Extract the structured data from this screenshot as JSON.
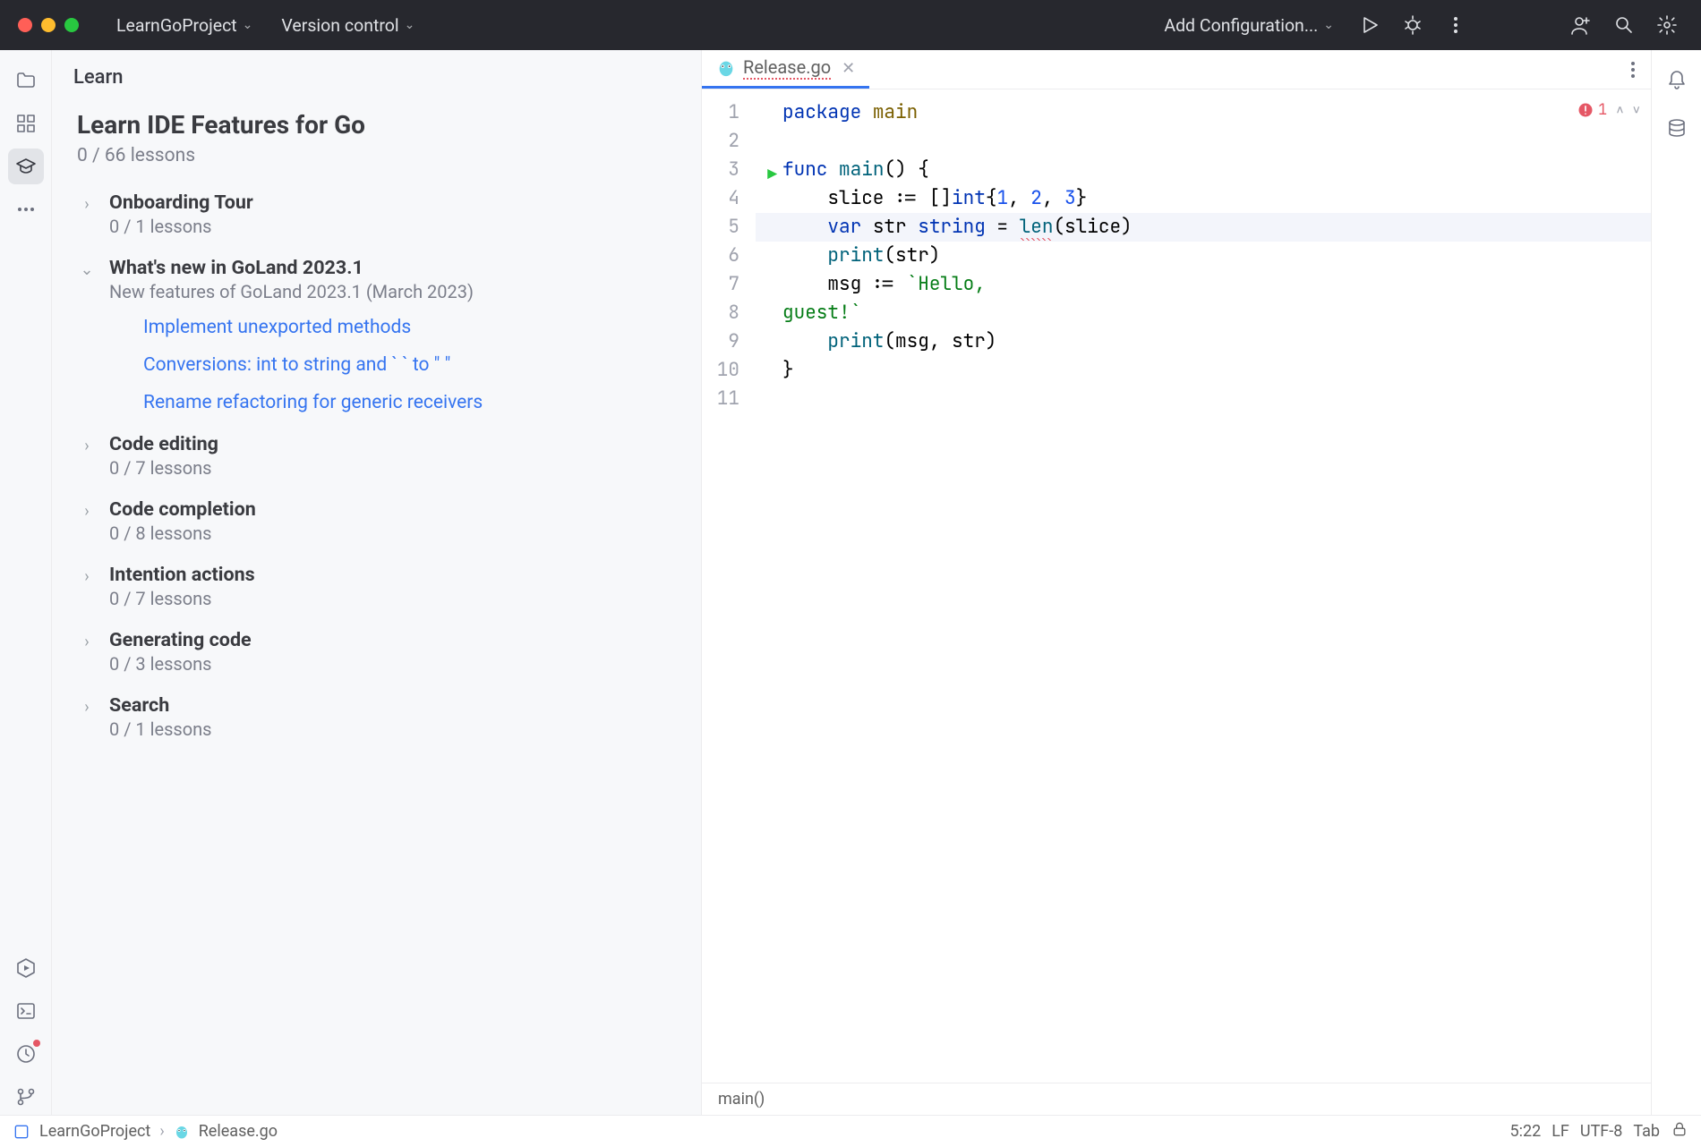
{
  "titlebar": {
    "project": "LearnGoProject",
    "vcs": "Version control",
    "runConfig": "Add Configuration..."
  },
  "learn": {
    "header": "Learn",
    "courseTitle": "Learn IDE Features for Go",
    "courseProgress": "0 / 66 lessons",
    "sections": [
      {
        "title": "Onboarding Tour",
        "sub": "0 / 1 lessons",
        "expanded": false
      },
      {
        "title": "What's new in GoLand 2023.1",
        "sub": "New features of GoLand 2023.1 (March 2023)",
        "expanded": true,
        "lessons": [
          "Implement unexported methods",
          "Conversions: int to string and ` ` to \" \"",
          "Rename refactoring for generic receivers"
        ]
      },
      {
        "title": "Code editing",
        "sub": "0 / 7 lessons",
        "expanded": false
      },
      {
        "title": "Code completion",
        "sub": "0 / 8 lessons",
        "expanded": false
      },
      {
        "title": "Intention actions",
        "sub": "0 / 7 lessons",
        "expanded": false
      },
      {
        "title": "Generating code",
        "sub": "0 / 3 lessons",
        "expanded": false
      },
      {
        "title": "Search",
        "sub": "0 / 1 lessons",
        "expanded": false
      }
    ]
  },
  "editor": {
    "tab": "Release.go",
    "inspections": {
      "errors": 1
    },
    "breadcrumb": "main()",
    "code": {
      "l1_kw": "package",
      "l1_pkg": "main",
      "l3_kw": "func",
      "l3_name": "main",
      "l3_rest": "() {",
      "l4a": "    slice ",
      "l4b": ":=",
      "l4c": " []",
      "l4_int": "int",
      "l4d": "{",
      "l4n1": "1",
      "l4n2": "2",
      "l4n3": "3",
      "l4e": "}",
      "l5_var": "var",
      "l5_s": " str ",
      "l5_type": "string",
      "l5_eq": " = ",
      "l5_len": "len",
      "l5_rest": "(slice)",
      "l6_print": "print",
      "l6_rest": "(str)",
      "l7a": "    msg ",
      "l7b": ":=",
      "l7c": " ",
      "l7_str": "`Hello,",
      "l8_str": "guest!`",
      "l9_print": "print",
      "l9_rest": "(msg, str)",
      "l10": "}"
    }
  },
  "statusbar": {
    "proj": "LearnGoProject",
    "file": "Release.go",
    "pos": "5:22",
    "sep": "LF",
    "enc": "UTF-8",
    "indent": "Tab"
  },
  "icons": {
    "chevDown": "⌄",
    "chevRight": "›"
  }
}
